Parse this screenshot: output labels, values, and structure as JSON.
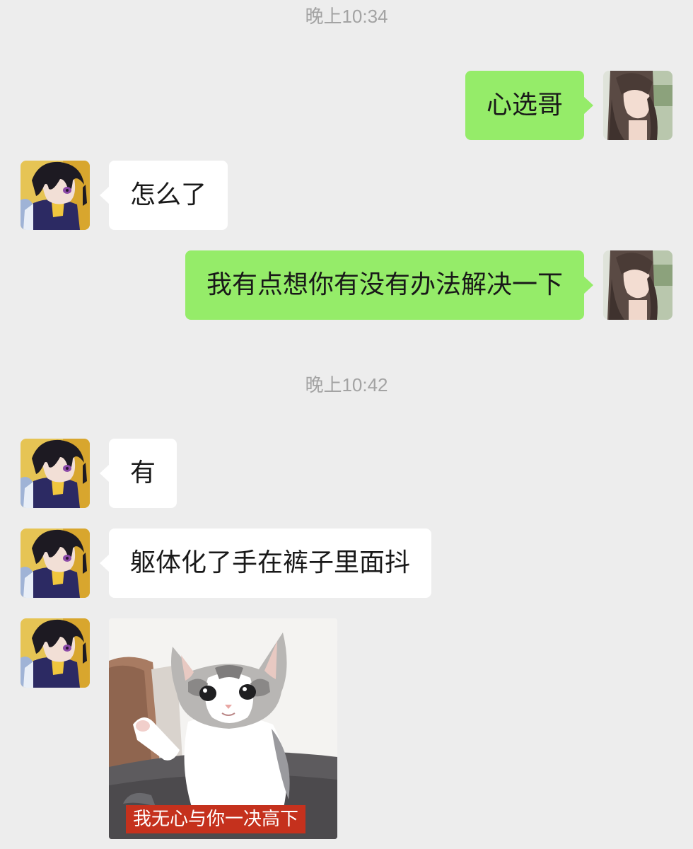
{
  "chat": {
    "timestamps": [
      "晚上10:34",
      "晚上10:42"
    ],
    "messages": [
      {
        "sender": "me",
        "text": "心选哥"
      },
      {
        "sender": "contact",
        "text": "怎么了"
      },
      {
        "sender": "me",
        "text": "我有点想你有没有办法解决一下"
      },
      {
        "sender": "contact",
        "text": "有"
      },
      {
        "sender": "contact",
        "text": "躯体化了手在裤子里面抖"
      },
      {
        "sender": "contact",
        "type": "sticker",
        "icon": "kitten-sticker",
        "caption": "我无心与你一决高下"
      }
    ]
  },
  "colors": {
    "background": "#ededed",
    "my_bubble": "#95ec69",
    "contact_bubble": "#ffffff",
    "timestamp_text": "#a3a3a3",
    "caption_bg": "#c5311d"
  }
}
